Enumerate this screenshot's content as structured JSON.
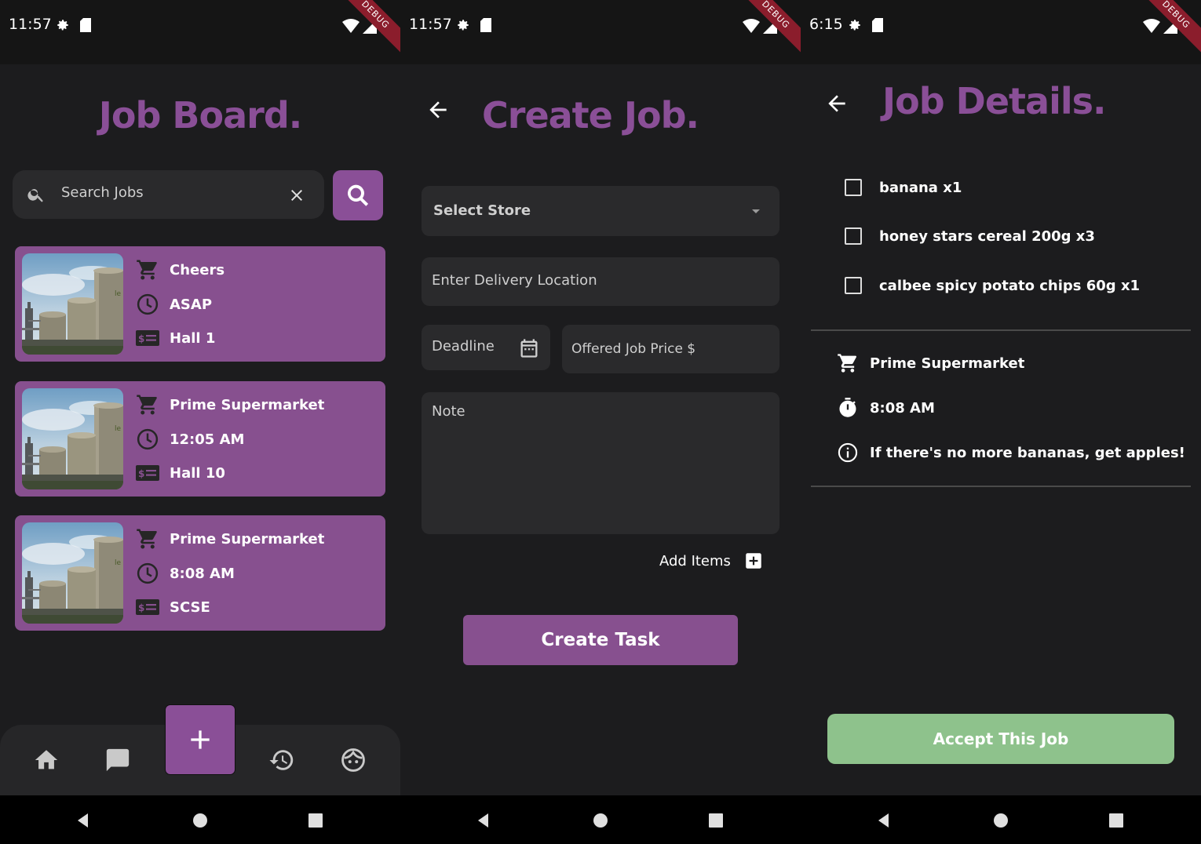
{
  "screens": [
    {
      "status": {
        "time": "11:57",
        "debug": "DEBUG"
      },
      "title": "Job Board.",
      "search": {
        "placeholder": "Search Jobs"
      },
      "jobs": [
        {
          "store": "Cheers",
          "time": "ASAP",
          "location": "Hall 1"
        },
        {
          "store": "Prime Supermarket",
          "time": "12:05 AM",
          "location": "Hall 10"
        },
        {
          "store": "Prime Supermarket",
          "time": "8:08 AM",
          "location": "SCSE"
        }
      ]
    },
    {
      "status": {
        "time": "11:57",
        "debug": "DEBUG"
      },
      "title": "Create Job.",
      "form": {
        "store_placeholder": "Select Store",
        "location_placeholder": "Enter Delivery Location",
        "deadline_placeholder": "Deadline",
        "price_placeholder": "Offered Job Price $",
        "note_placeholder": "Note",
        "add_items_label": "Add Items",
        "create_label": "Create Task"
      }
    },
    {
      "status": {
        "time": "6:15",
        "debug": "DEBUG"
      },
      "title": "Job Details.",
      "items": [
        "banana x1",
        "honey stars cereal 200g x3",
        "calbee spicy potato chips 60g x1"
      ],
      "details": {
        "store": "Prime Supermarket",
        "time": "8:08 AM",
        "note": "If there's no more bananas, get apples!"
      },
      "accept_label": "Accept This Job"
    }
  ],
  "colors": {
    "accent": "#8a4f97",
    "card": "#87508f",
    "accept": "#8ec28c",
    "background": "#1c1c1e"
  }
}
